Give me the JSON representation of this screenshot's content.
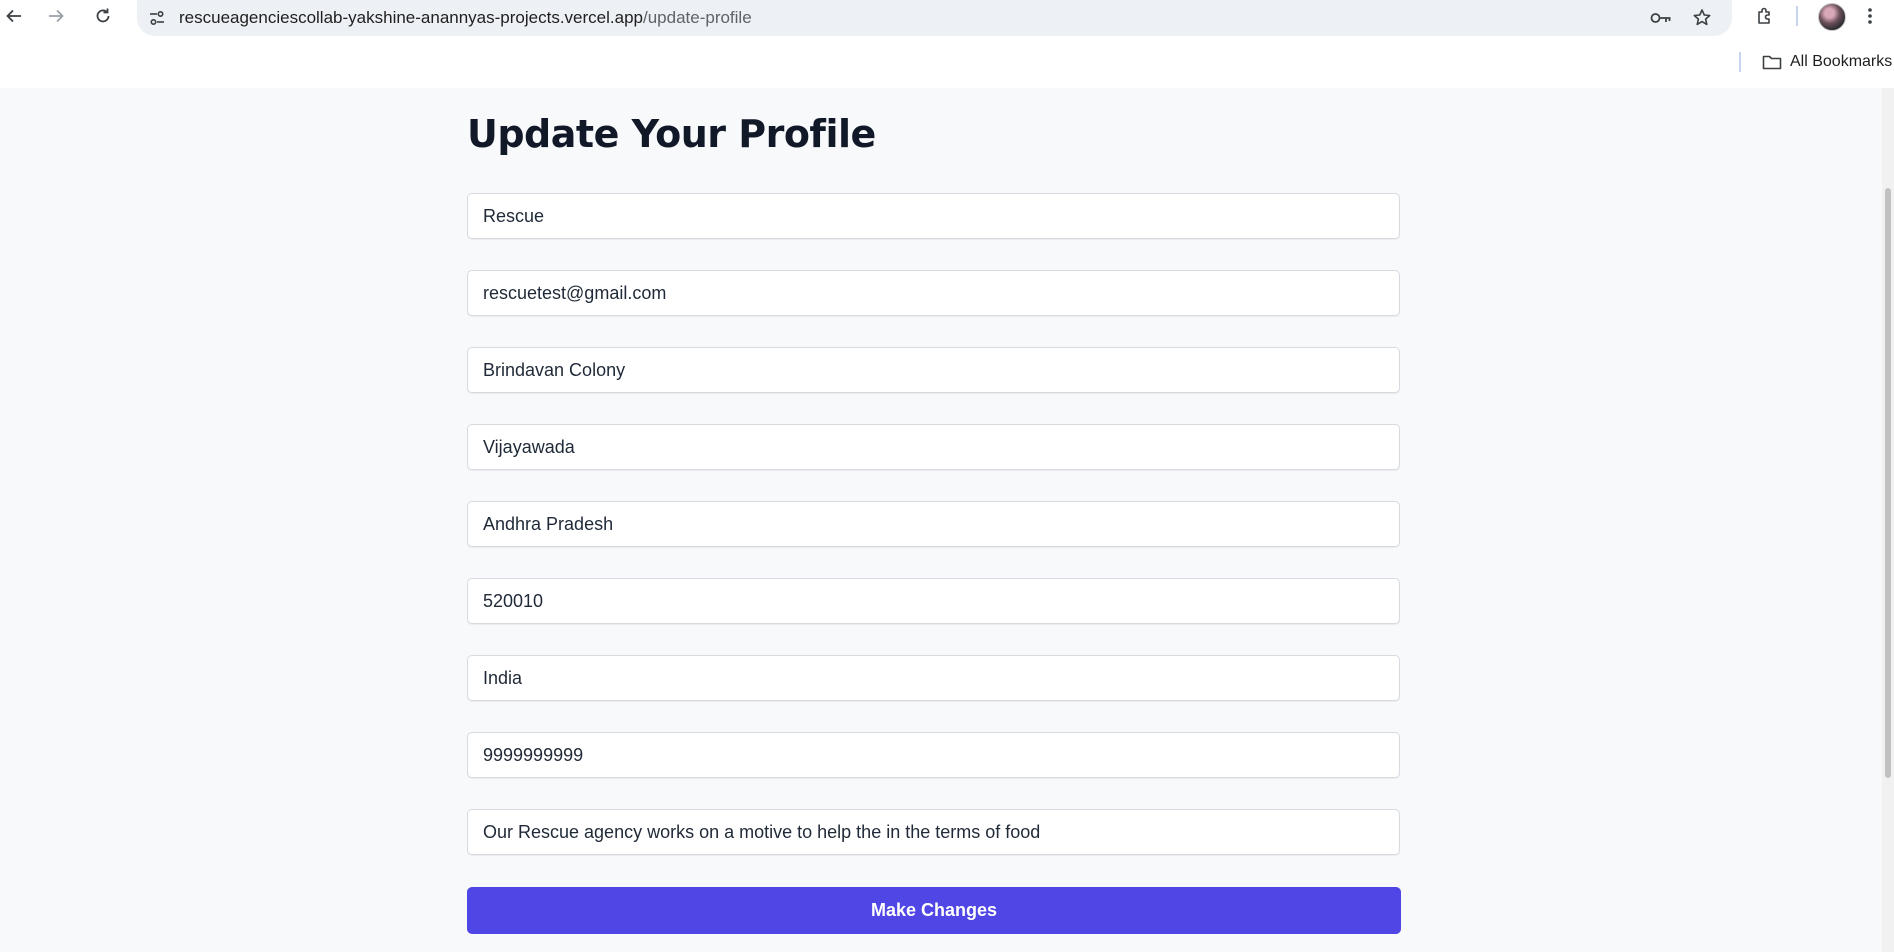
{
  "browser": {
    "url_host": "rescueagenciescollab-yakshine-anannyas-projects.vercel.app",
    "url_path": "/update-profile",
    "bookmarks_label": "All Bookmarks"
  },
  "page": {
    "title": "Update Your Profile",
    "fields": {
      "name": "Rescue",
      "email": "rescuetest@gmail.com",
      "address": "Brindavan Colony",
      "city": "Vijayawada",
      "state": "Andhra Pradesh",
      "pincode": "520010",
      "country": "India",
      "phone": "9999999999",
      "description": "Our Rescue agency works on a motive to help the in the terms of food"
    },
    "submit_label": "Make Changes"
  },
  "colors": {
    "accent": "#4f46e5",
    "page_bg": "#f8f9fb",
    "title": "#111827"
  }
}
